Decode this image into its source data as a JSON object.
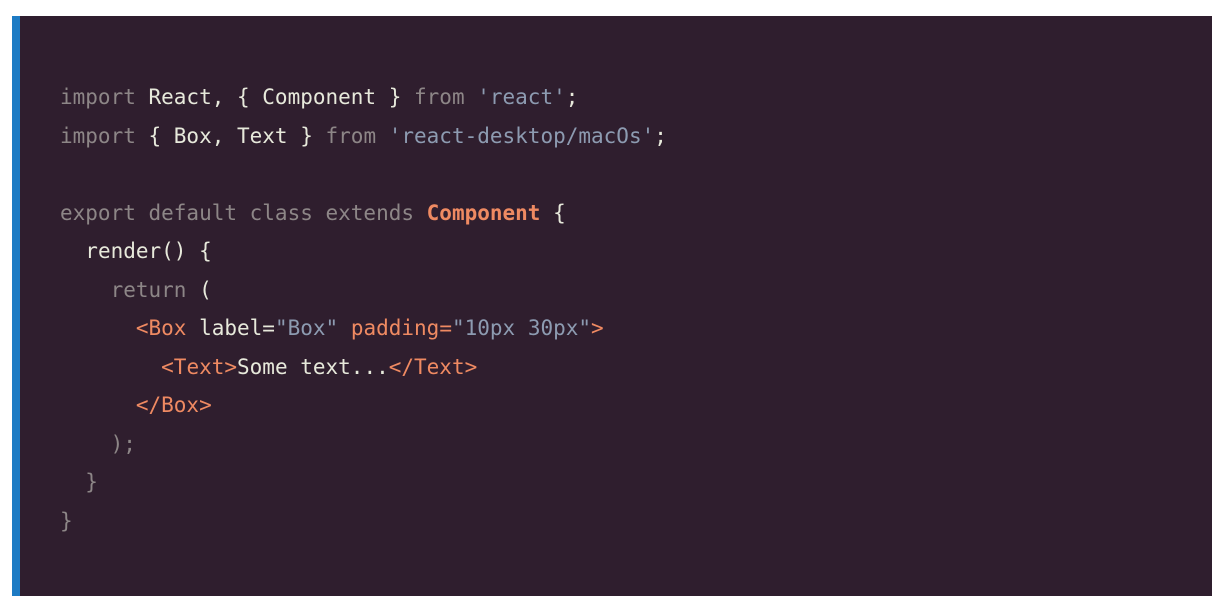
{
  "code": {
    "line1": {
      "kw_import": "import",
      "def": " React, { Component } ",
      "kw_from": "from",
      "str": " 'react'",
      "end": ";"
    },
    "line2": {
      "kw_import": "import",
      "def": " { Box, Text } ",
      "kw_from": "from",
      "str": " 'react-desktop/macOs'",
      "end": ";"
    },
    "line4": {
      "kw": "export default class extends ",
      "cls": "Component",
      "end": " {"
    },
    "line5": {
      "fn": "render() {"
    },
    "line6": {
      "kw_return": "return",
      "open": " ("
    },
    "line7": {
      "tag_open": "<Box",
      "attr_label": " label=",
      "str_label": "\"Box\"",
      "attr_padding": " padding=",
      "str_padding": "\"10px 30px\"",
      "tag_close": ">"
    },
    "line8": {
      "tag_open": "<Text>",
      "text": "Some text...",
      "tag_close": "</Text>"
    },
    "line9": {
      "tag": "</Box>"
    },
    "line10": {
      "close": ");"
    },
    "line11": {
      "close": "}"
    },
    "line12": {
      "close": "}"
    }
  },
  "colors": {
    "background": "#2f1e2e",
    "accent_bar": "#1d7bc4",
    "keyword": "#8d8687",
    "string": "#8d9bb1",
    "highlight": "#ef8a62",
    "default": "#e7e9db"
  }
}
